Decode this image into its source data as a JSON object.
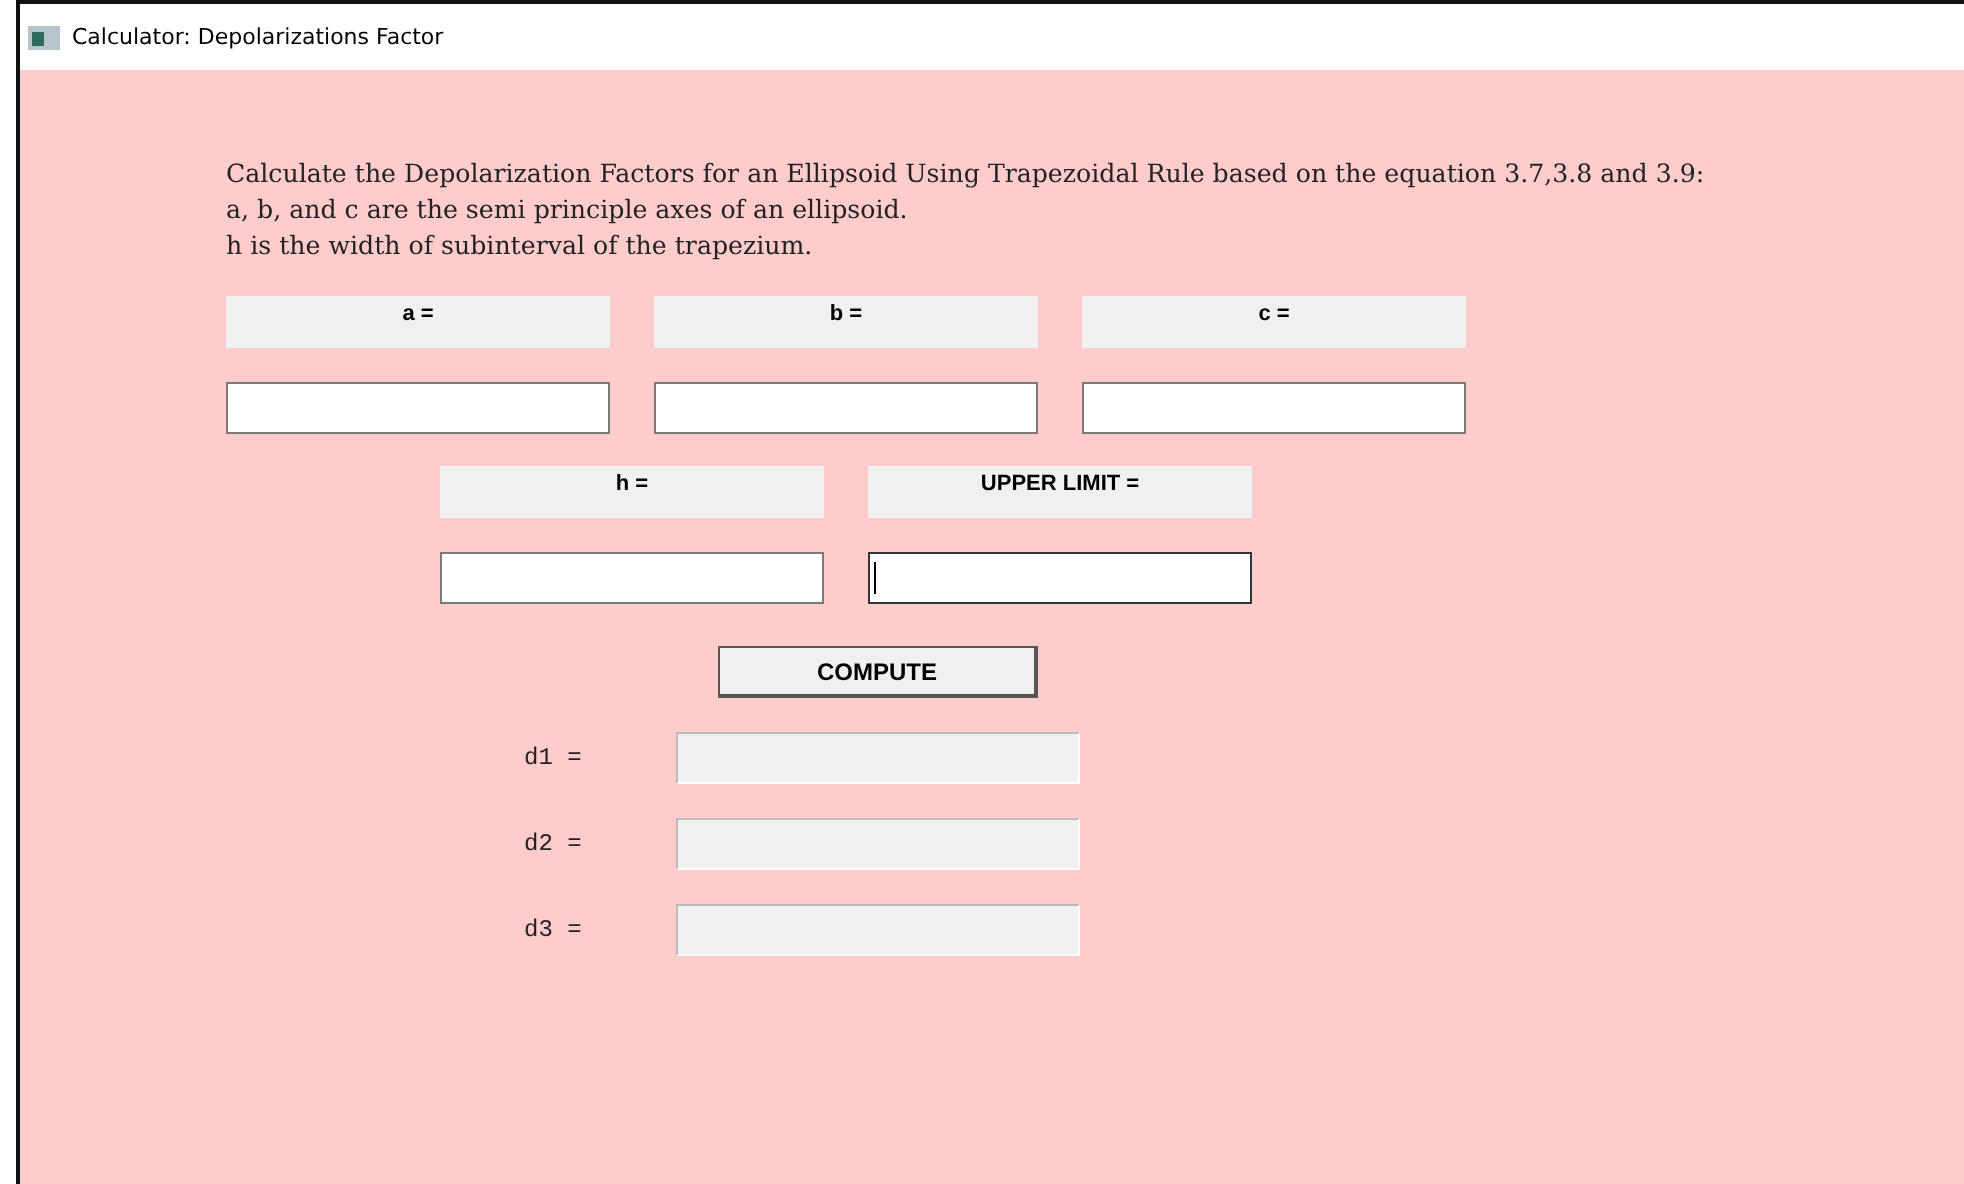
{
  "window": {
    "title": "Calculator: Depolarizations Factor"
  },
  "description": [
    "Calculate the Depolarization Factors for an Ellipsoid Using Trapezoidal Rule based on the equation 3.7,3.8 and 3.9:",
    "a, b, and c are the semi principle axes of an ellipsoid.",
    "h is the width of subinterval of the trapezium."
  ],
  "input_rows": [
    [
      {
        "label": "a =",
        "focused": false
      },
      {
        "label": "b =",
        "focused": false
      },
      {
        "label": "c =",
        "focused": false
      }
    ],
    [
      {
        "label": "h =",
        "focused": false
      },
      {
        "label": "UPPER LIMIT =",
        "focused": true
      }
    ]
  ],
  "compute_button": "COMPUTE",
  "outputs": [
    {
      "label": "d1 ="
    },
    {
      "label": "d2 ="
    },
    {
      "label": "d3 ="
    }
  ]
}
